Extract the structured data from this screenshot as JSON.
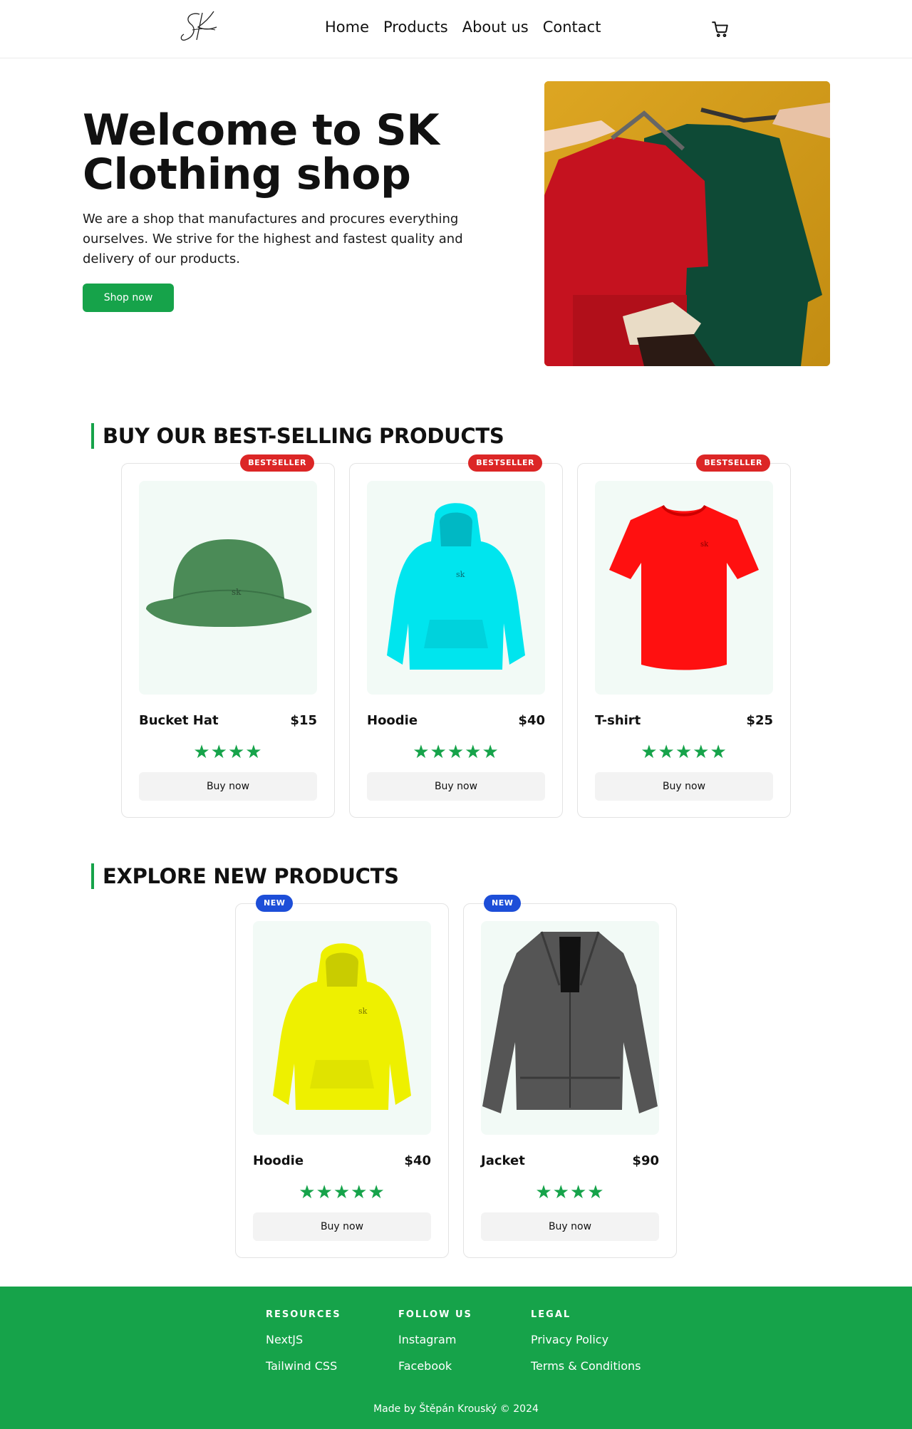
{
  "header": {
    "logo_alt": "SK",
    "nav": [
      "Home",
      "Products",
      "About us",
      "Contact"
    ],
    "cart_icon": "shopping-cart-icon"
  },
  "hero": {
    "title": "Welcome to SK Clothing shop",
    "text": "We are a shop that manufactures and procures everything ourselves. We strive for the highest and fastest quality and delivery of our products.",
    "button": "Shop now"
  },
  "bestsellers": {
    "heading": "BUY OUR BEST-SELLING PRODUCTS",
    "badge": "BESTSELLER",
    "items": [
      {
        "name": "Bucket Hat",
        "price": "$15",
        "rating": 4,
        "button": "Buy now",
        "color": "#4b8b57"
      },
      {
        "name": "Hoodie",
        "price": "$40",
        "rating": 5,
        "button": "Buy now",
        "color": "#00e5ee"
      },
      {
        "name": "T-shirt",
        "price": "$25",
        "rating": 5,
        "button": "Buy now",
        "color": "#ff1010"
      }
    ]
  },
  "new_products": {
    "heading": "EXPLORE NEW PRODUCTS",
    "badge": "NEW",
    "items": [
      {
        "name": "Hoodie",
        "price": "$40",
        "rating": 5,
        "button": "Buy now",
        "color": "#eef000"
      },
      {
        "name": "Jacket",
        "price": "$90",
        "rating": 4,
        "button": "Buy now",
        "color": "#555555"
      }
    ]
  },
  "footer": {
    "columns": [
      {
        "title": "RESOURCES",
        "links": [
          "NextJS",
          "Tailwind CSS"
        ]
      },
      {
        "title": "FOLLOW US",
        "links": [
          "Instagram",
          "Facebook"
        ]
      },
      {
        "title": "LEGAL",
        "links": [
          "Privacy Policy",
          "Terms & Conditions"
        ]
      }
    ],
    "copyright": "Made by Štěpán Krouský © 2024"
  },
  "colors": {
    "accent": "#16a34a",
    "bestseller_badge": "#dc2626",
    "new_badge": "#1d4ed8"
  }
}
